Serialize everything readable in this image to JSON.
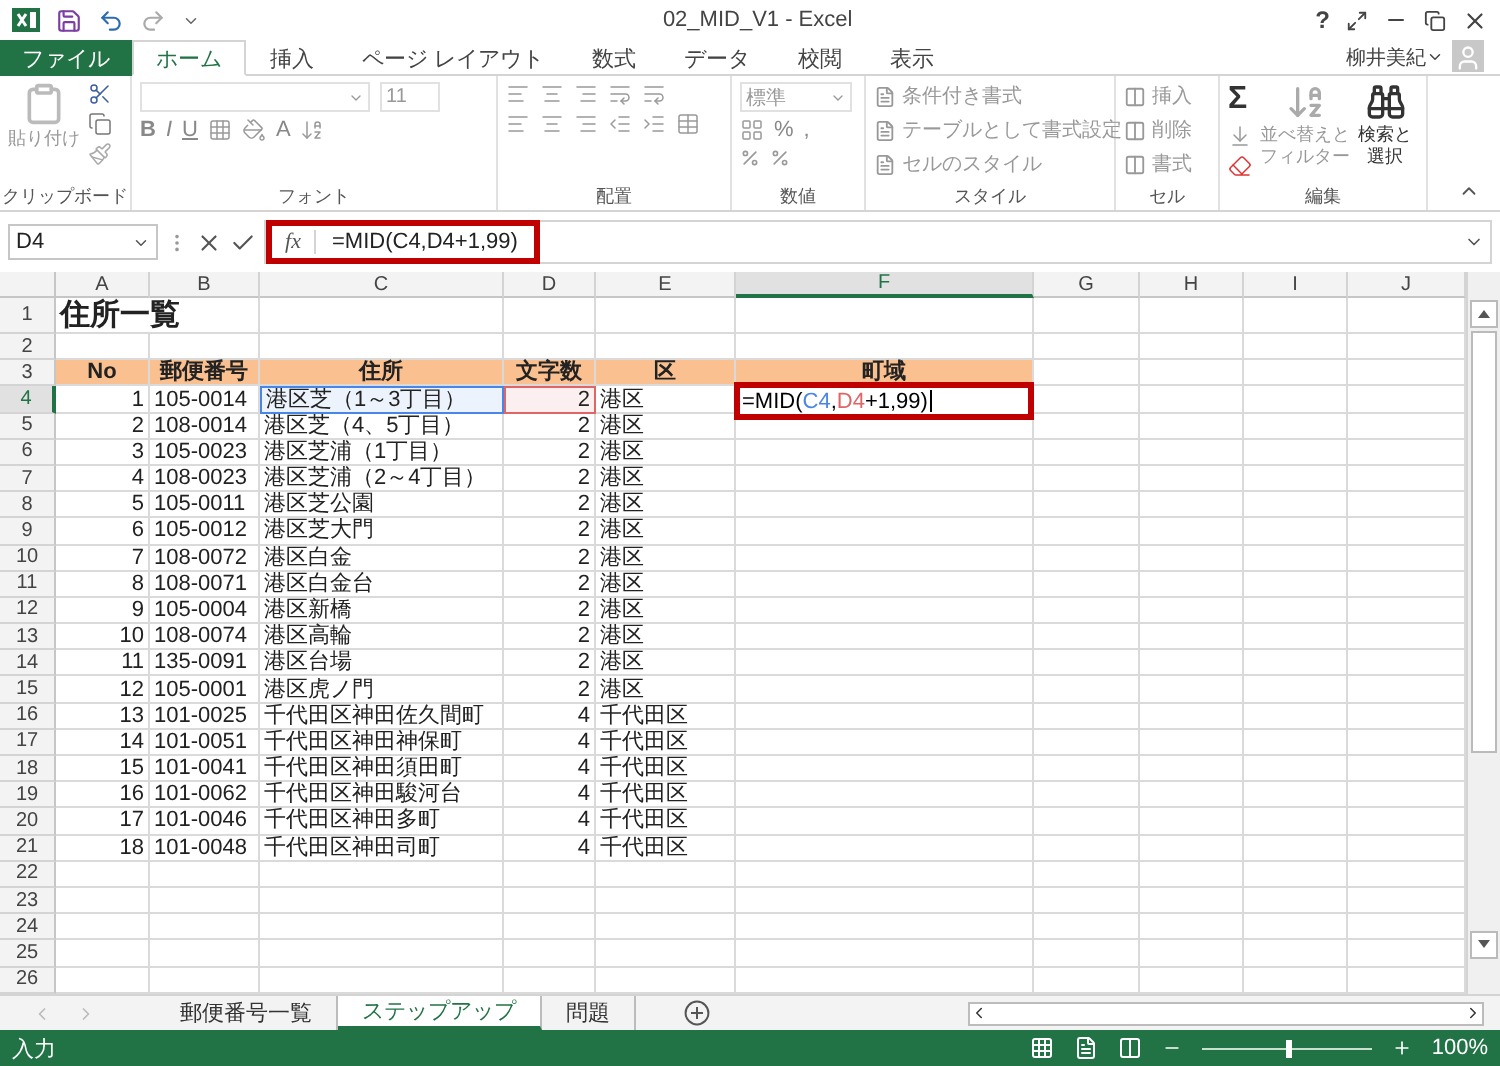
{
  "window": {
    "title": "02_MID_V1 - Excel",
    "help": "?"
  },
  "file_button": "ファイル",
  "tabs": [
    {
      "label": "ホーム",
      "selected": true
    },
    {
      "label": "挿入",
      "selected": false
    },
    {
      "label": "ページ レイアウト",
      "selected": false
    },
    {
      "label": "数式",
      "selected": false
    },
    {
      "label": "データ",
      "selected": false
    },
    {
      "label": "校閲",
      "selected": false
    },
    {
      "label": "表示",
      "selected": false
    }
  ],
  "user": "柳井美紀",
  "ribbon": {
    "clipboard": {
      "label": "クリップボード",
      "paste": "貼り付け"
    },
    "font": {
      "label": "フォント",
      "size": "11",
      "bold": "B",
      "italic": "I",
      "underline": "U",
      "font_color": "A"
    },
    "alignment": {
      "label": "配置"
    },
    "number": {
      "label": "数値",
      "format": "標準",
      "percent": "%",
      "comma": ","
    },
    "styles": {
      "label": "スタイル",
      "items": [
        "条件付き書式",
        "テーブルとして書式設定",
        "セルのスタイル"
      ]
    },
    "cells": {
      "label": "セル",
      "items": [
        "挿入",
        "削除",
        "書式"
      ]
    },
    "editing": {
      "label": "編集",
      "sum": "Σ",
      "sort": [
        "並べ替えと",
        "フィルター"
      ],
      "find": [
        "検索と",
        "選択"
      ]
    }
  },
  "formula_bar": {
    "name_box": "D4",
    "fx": "fx",
    "formula": "=MID(C4,D4+1,99)"
  },
  "columns": [
    {
      "label": "A",
      "selected": false
    },
    {
      "label": "B",
      "selected": false
    },
    {
      "label": "C",
      "selected": false
    },
    {
      "label": "D",
      "selected": false
    },
    {
      "label": "E",
      "selected": false
    },
    {
      "label": "F",
      "selected": true
    },
    {
      "label": "G",
      "selected": false
    },
    {
      "label": "H",
      "selected": false
    },
    {
      "label": "I",
      "selected": false
    },
    {
      "label": "J",
      "selected": false
    }
  ],
  "rows": [
    {
      "number": "1",
      "kind": "title",
      "selected": false,
      "cells": [
        "住所一覧"
      ]
    },
    {
      "number": "2",
      "kind": "blank",
      "selected": false
    },
    {
      "number": "3",
      "kind": "header",
      "selected": false,
      "cells": [
        "No",
        "郵便番号",
        "住所",
        "文字数",
        "区",
        "町域"
      ]
    },
    {
      "number": "4",
      "kind": "data",
      "selected": true,
      "cells": [
        "1",
        "105-0014",
        {
          "kind": "ref",
          "text": "港区芝（1～3丁目）",
          "color": "#4a86e8"
        },
        {
          "kind": "ref",
          "text": "2",
          "color": "#e06666"
        },
        "港区",
        {
          "kind": "editing",
          "parts": [
            {
              "text": "=MID("
            },
            {
              "text": "C4",
              "color": "#4a86e8"
            },
            {
              "text": ","
            },
            {
              "text": "D4",
              "color": "#e06666"
            },
            {
              "text": "+1,99)"
            }
          ]
        }
      ]
    },
    {
      "number": "5",
      "kind": "data",
      "selected": false,
      "cells": [
        "2",
        "108-0014",
        "港区芝（4、5丁目）",
        "2",
        "港区"
      ]
    },
    {
      "number": "6",
      "kind": "data",
      "selected": false,
      "cells": [
        "3",
        "105-0023",
        "港区芝浦（1丁目）",
        "2",
        "港区"
      ]
    },
    {
      "number": "7",
      "kind": "data",
      "selected": false,
      "cells": [
        "4",
        "108-0023",
        "港区芝浦（2～4丁目）",
        "2",
        "港区"
      ]
    },
    {
      "number": "8",
      "kind": "data",
      "selected": false,
      "cells": [
        "5",
        "105-0011",
        "港区芝公園",
        "2",
        "港区"
      ]
    },
    {
      "number": "9",
      "kind": "data",
      "selected": false,
      "cells": [
        "6",
        "105-0012",
        "港区芝大門",
        "2",
        "港区"
      ]
    },
    {
      "number": "10",
      "kind": "data",
      "selected": false,
      "cells": [
        "7",
        "108-0072",
        "港区白金",
        "2",
        "港区"
      ]
    },
    {
      "number": "11",
      "kind": "data",
      "selected": false,
      "cells": [
        "8",
        "108-0071",
        "港区白金台",
        "2",
        "港区"
      ]
    },
    {
      "number": "12",
      "kind": "data",
      "selected": false,
      "cells": [
        "9",
        "105-0004",
        "港区新橋",
        "2",
        "港区"
      ]
    },
    {
      "number": "13",
      "kind": "data",
      "selected": false,
      "cells": [
        "10",
        "108-0074",
        "港区高輪",
        "2",
        "港区"
      ]
    },
    {
      "number": "14",
      "kind": "data",
      "selected": false,
      "cells": [
        "11",
        "135-0091",
        "港区台場",
        "2",
        "港区"
      ]
    },
    {
      "number": "15",
      "kind": "data",
      "selected": false,
      "cells": [
        "12",
        "105-0001",
        "港区虎ノ門",
        "2",
        "港区"
      ]
    },
    {
      "number": "16",
      "kind": "data",
      "selected": false,
      "cells": [
        "13",
        "101-0025",
        "千代田区神田佐久間町",
        "4",
        "千代田区"
      ]
    },
    {
      "number": "17",
      "kind": "data",
      "selected": false,
      "cells": [
        "14",
        "101-0051",
        "千代田区神田神保町",
        "4",
        "千代田区"
      ]
    },
    {
      "number": "18",
      "kind": "data",
      "selected": false,
      "cells": [
        "15",
        "101-0041",
        "千代田区神田須田町",
        "4",
        "千代田区"
      ]
    },
    {
      "number": "19",
      "kind": "data",
      "selected": false,
      "cells": [
        "16",
        "101-0062",
        "千代田区神田駿河台",
        "4",
        "千代田区"
      ]
    },
    {
      "number": "20",
      "kind": "data",
      "selected": false,
      "cells": [
        "17",
        "101-0046",
        "千代田区神田多町",
        "4",
        "千代田区"
      ]
    },
    {
      "number": "21",
      "kind": "data",
      "selected": false,
      "cells": [
        "18",
        "101-0048",
        "千代田区神田司町",
        "4",
        "千代田区"
      ]
    },
    {
      "number": "22",
      "kind": "blank",
      "selected": false
    },
    {
      "number": "23",
      "kind": "blank",
      "selected": false
    },
    {
      "number": "24",
      "kind": "blank",
      "selected": false
    },
    {
      "number": "25",
      "kind": "blank",
      "selected": false
    },
    {
      "number": "26",
      "kind": "blank",
      "selected": false
    }
  ],
  "sheets": [
    {
      "label": "郵便番号一覧",
      "selected": false
    },
    {
      "label": "ステップアップ",
      "selected": true
    },
    {
      "label": "問題",
      "selected": false
    }
  ],
  "status_bar": {
    "mode": "入力",
    "zoom": "100%",
    "zoom_slider": {
      "level": 0.5
    }
  }
}
